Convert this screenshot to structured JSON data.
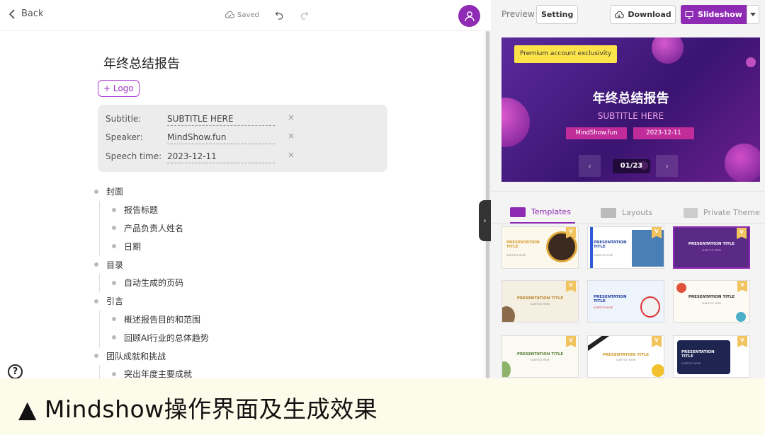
{
  "editor": {
    "back_label": "Back",
    "saved_label": "Saved",
    "title": "年终总结报告",
    "logo_button": "+ Logo",
    "fields": [
      {
        "label": "Subtitle:",
        "value": "SUBTITLE HERE"
      },
      {
        "label": "Speaker:",
        "value": "MindShow.fun"
      },
      {
        "label": "Speech time:",
        "value": "2023-12-11"
      }
    ],
    "clear_icon": "×",
    "outline": [
      {
        "level": 1,
        "text": "封面"
      },
      {
        "level": 2,
        "text": "报告标题"
      },
      {
        "level": 2,
        "text": "产品负责人姓名"
      },
      {
        "level": 2,
        "text": "日期"
      },
      {
        "level": 1,
        "text": "目录"
      },
      {
        "level": 2,
        "text": "自动生成的页码"
      },
      {
        "level": 1,
        "text": "引言"
      },
      {
        "level": 2,
        "text": "概述报告目的和范围"
      },
      {
        "level": 2,
        "text": "回顾AI行业的总体趋势"
      },
      {
        "level": 1,
        "text": "团队成就和挑战"
      },
      {
        "level": 2,
        "text": "突出年度主要成就"
      }
    ],
    "help_label": "?",
    "collapse_label": "›"
  },
  "panel": {
    "preview_label": "Preview",
    "setting_label": "Setting",
    "download_label": "Download",
    "slideshow_label": "Slideshow",
    "slide": {
      "badge": "Premium account exclusivity",
      "title": "年终总结报告",
      "subtitle": "SUBTITLE HERE",
      "speaker": "MindShow.fun",
      "date": "2023-12-11",
      "page_indicator": "01/23",
      "prev": "‹",
      "next": "›"
    },
    "tabs": [
      {
        "label": "Templates",
        "active": true
      },
      {
        "label": "Layouts",
        "active": false
      },
      {
        "label": "Private Theme",
        "active": false
      }
    ],
    "templates": [
      {
        "title": "PRESENTATION TITLE",
        "subtitle": "SUBTITLE HERE",
        "vip": "V"
      },
      {
        "title": "PRESENTATION TITLE",
        "subtitle": "SUBTITLE HERE",
        "vip": "V"
      },
      {
        "title": "PRESENTATION TITLE",
        "subtitle": "SUBTITLE HERE",
        "vip": "V"
      },
      {
        "title": "PRESENTATION TITLE",
        "subtitle": "SUBTITLE HERE",
        "vip": "V"
      },
      {
        "title": "PRESENTATION TITLE",
        "subtitle": "SUBTITLE HERE",
        "vip": ""
      },
      {
        "title": "PRESENTATION TITLE",
        "subtitle": "SUBTITLE HERE",
        "vip": "V"
      },
      {
        "title": "PRESENTATION TITLE",
        "subtitle": "SUBTITLE HERE",
        "vip": "V"
      },
      {
        "title": "PRESENTATION TITLE",
        "subtitle": "SUBTITLE HERE",
        "vip": "V"
      },
      {
        "title": "PRESENTATION TITLE",
        "subtitle": "SUBTITLE HERE",
        "vip": "V"
      }
    ]
  },
  "caption": "▲ Mindshow操作界面及生成效果",
  "colors": {
    "accent": "#8e2ab3",
    "badge": "#fde34a",
    "caption_bg": "#fdfbe9"
  }
}
